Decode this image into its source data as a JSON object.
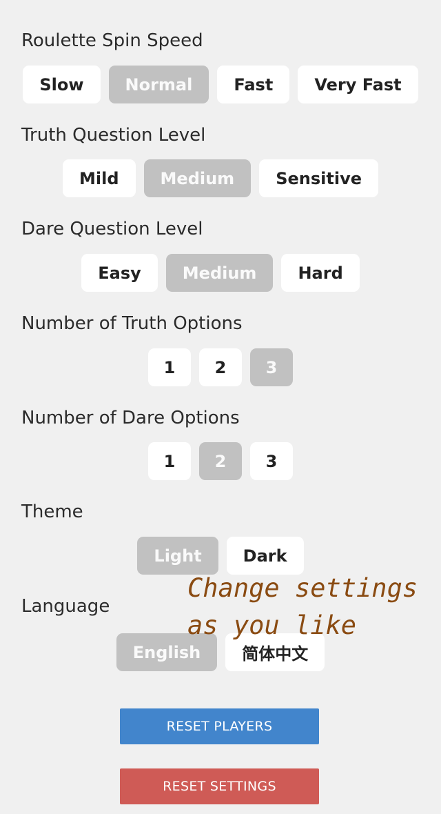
{
  "colors": {
    "background": "#f0f0f0",
    "option_bg": "#ffffff",
    "option_selected_bg": "#c1c1c1",
    "reset_players": "#4285cc",
    "reset_settings": "#cf5b56",
    "annotation": "#8a4b12"
  },
  "spin_speed": {
    "title": "Roulette Spin Speed",
    "options": [
      "Slow",
      "Normal",
      "Fast",
      "Very Fast"
    ],
    "selected": "Normal"
  },
  "truth_level": {
    "title": "Truth Question Level",
    "options": [
      "Mild",
      "Medium",
      "Sensitive"
    ],
    "selected": "Medium"
  },
  "dare_level": {
    "title": "Dare Question Level",
    "options": [
      "Easy",
      "Medium",
      "Hard"
    ],
    "selected": "Medium"
  },
  "truth_count": {
    "title": "Number of Truth Options",
    "options": [
      "1",
      "2",
      "3"
    ],
    "selected": "3"
  },
  "dare_count": {
    "title": "Number of Dare Options",
    "options": [
      "1",
      "2",
      "3"
    ],
    "selected": "2"
  },
  "theme": {
    "title": "Theme",
    "options": [
      "Light",
      "Dark"
    ],
    "selected": "Light"
  },
  "language": {
    "title": "Language",
    "options": [
      "English",
      "简体中文"
    ],
    "selected": "English"
  },
  "actions": {
    "reset_players": "RESET PLAYERS",
    "reset_settings": "RESET SETTINGS"
  },
  "annotation": {
    "line1": "Change settings",
    "line2": "as you like"
  }
}
